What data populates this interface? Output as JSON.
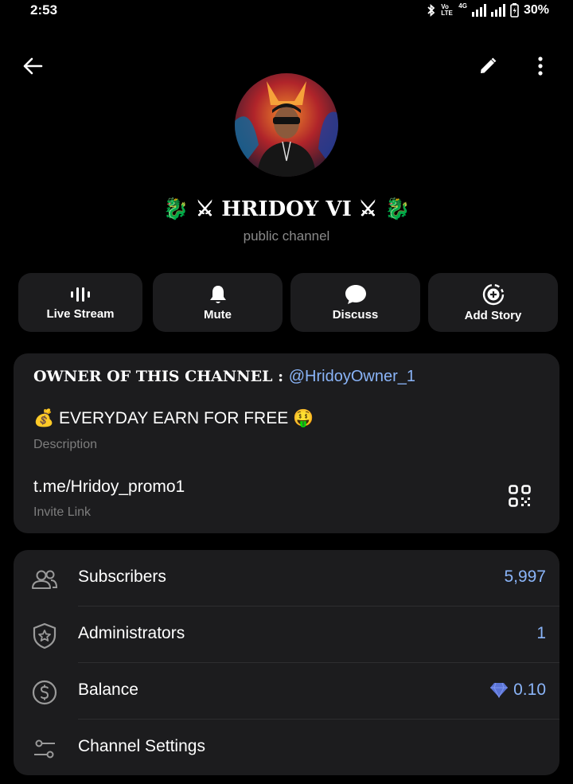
{
  "status_bar": {
    "time": "2:53",
    "network": "4G",
    "volte": "Vo LTE",
    "battery": "30%"
  },
  "channel": {
    "name": "🐉 ⚔ HRIDOY VI ⚔ 🐉",
    "type_label": "public channel"
  },
  "actions": [
    {
      "label": "Live Stream",
      "icon": "live-stream-icon"
    },
    {
      "label": "Mute",
      "icon": "bell-icon"
    },
    {
      "label": "Discuss",
      "icon": "chat-bubble-icon"
    },
    {
      "label": "Add Story",
      "icon": "add-story-icon"
    }
  ],
  "info": {
    "owner_label": "OWNER OF THIS CHANNEL : ",
    "owner_handle": "@HridoyOwner_1",
    "description": "💰 EVERYDAY EARN FOR FREE 🤑",
    "description_caption": "Description",
    "invite_link": "t.me/Hridoy_promo1",
    "invite_caption": "Invite Link"
  },
  "stats": {
    "subscribers": {
      "label": "Subscribers",
      "value": "5,997"
    },
    "administrators": {
      "label": "Administrators",
      "value": "1"
    },
    "balance": {
      "label": "Balance",
      "value": "0.10"
    },
    "settings": {
      "label": "Channel Settings"
    }
  },
  "colors": {
    "accent": "#8ab4f8",
    "card": "#1c1c1e",
    "background": "#000000",
    "muted": "#8a8a8a"
  }
}
